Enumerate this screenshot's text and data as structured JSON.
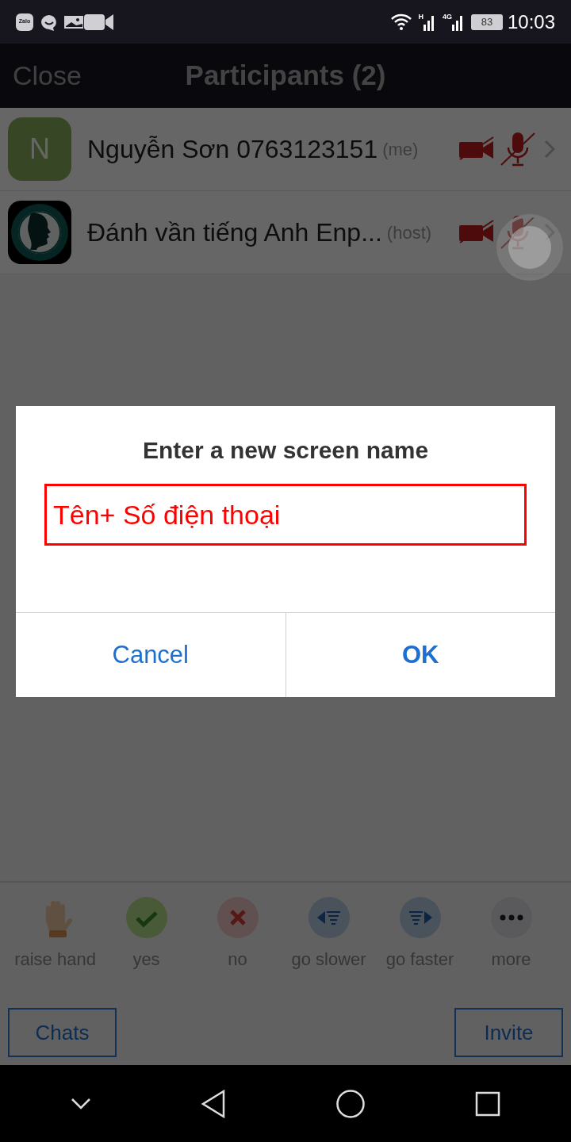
{
  "status_bar": {
    "notification_label": "Zalo",
    "signal_labels": [
      "H",
      "4G"
    ],
    "battery": "83",
    "time": "10:03"
  },
  "header": {
    "close": "Close",
    "title": "Participants (2)"
  },
  "participants": [
    {
      "name": "Nguyễn Sơn 0763123151",
      "role": "(me)",
      "avatar": {
        "kind": "initial",
        "letter": "N"
      },
      "video_off": true,
      "muted": true
    },
    {
      "name": "Đánh vần tiếng Anh Enp...",
      "role": "(host)",
      "video_off": true,
      "muted": true
    }
  ],
  "reactions": [
    {
      "kind": "hand",
      "label": "raise hand"
    },
    {
      "kind": "yes",
      "label": "yes"
    },
    {
      "kind": "no",
      "label": "no"
    },
    {
      "kind": "slower",
      "label": "go slower"
    },
    {
      "kind": "faster",
      "label": "go faster"
    },
    {
      "kind": "more",
      "label": "more"
    }
  ],
  "footer": {
    "left_button": "Chats",
    "right_button": "Invite"
  },
  "dialog": {
    "title": "Enter a new screen name",
    "field_value": "Tên+ Số điện thoại",
    "buttons": [
      {
        "label": "Cancel",
        "primary": false
      },
      {
        "label": "OK",
        "primary": true
      }
    ]
  }
}
